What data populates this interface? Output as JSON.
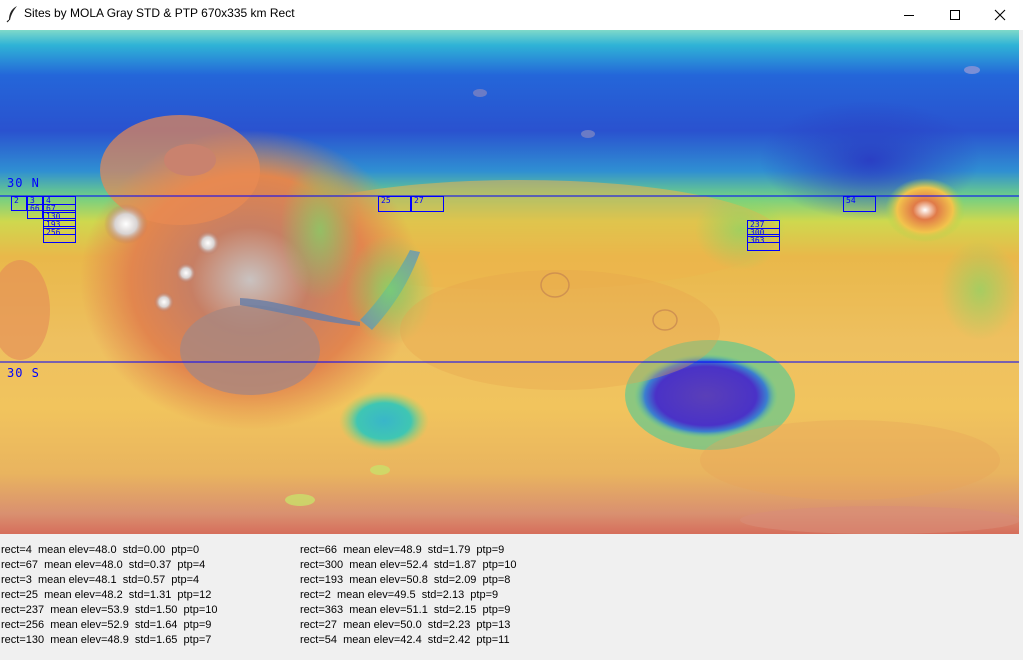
{
  "window": {
    "title": "Sites by MOLA Gray STD & PTP 670x335 km Rect"
  },
  "icons": {
    "app": "feather-icon",
    "minimize": "minimize-icon",
    "maximize": "maximize-icon",
    "close": "close-icon"
  },
  "map": {
    "lat_north_label": "30  N",
    "lat_south_label": "30  S",
    "rect_labels": [
      "2",
      "3",
      "4",
      "66",
      "67",
      "130",
      "193",
      "256",
      "25",
      "27",
      "237",
      "300",
      "363",
      "54"
    ]
  },
  "stats": {
    "left": [
      "rect=4  mean elev=48.0  std=0.00  ptp=0",
      "rect=67  mean elev=48.0  std=0.37  ptp=4",
      "rect=3  mean elev=48.1  std=0.57  ptp=4",
      "rect=25  mean elev=48.2  std=1.31  ptp=12",
      "rect=237  mean elev=53.9  std=1.50  ptp=10",
      "rect=256  mean elev=52.9  std=1.64  ptp=9",
      "rect=130  mean elev=48.9  std=1.65  ptp=7"
    ],
    "right": [
      "rect=66  mean elev=48.9  std=1.79  ptp=9",
      "rect=300  mean elev=52.4  std=1.87  ptp=10",
      "rect=193  mean elev=50.8  std=2.09  ptp=8",
      "rect=2  mean elev=49.5  std=2.13  ptp=9",
      "rect=363  mean elev=51.1  std=2.15  ptp=9",
      "rect=27  mean elev=50.0  std=2.23  ptp=13",
      "rect=54  mean elev=42.4  std=2.42  ptp=11"
    ]
  }
}
